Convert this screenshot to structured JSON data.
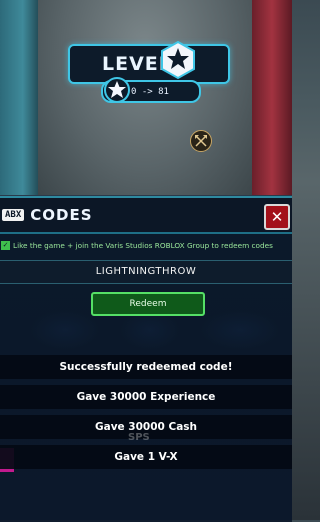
{
  "hud": {
    "level_label": "LEVEL",
    "xp_text": "0 -> 81"
  },
  "codes": {
    "badge": "ABX",
    "title": "CODES",
    "close_glyph": "✕",
    "checkbox_glyph": "✓",
    "info": "Like the game + join the Varis Studios ROBLOX Group to redeem codes",
    "code_value": "LIGHTNINGTHROW",
    "redeem_label": "Redeem"
  },
  "notifications": [
    "Successfully redeemed code!",
    "Gave 30000 Experience",
    "Gave 30000 Cash",
    "Gave 1 V-X"
  ],
  "background_text": {
    "sps": "SPS"
  },
  "colors": {
    "accent_cyan": "#3fc6e6",
    "redeem_green": "#55e066",
    "close_red": "#a3111a",
    "info_green": "#9be89c"
  },
  "icons": {
    "level_badge": "level-star-badge-icon",
    "xp": "star-icon",
    "emblem": "crossed-axes-emblem-icon",
    "close": "close-icon",
    "checkbox": "checkbox-icon"
  }
}
